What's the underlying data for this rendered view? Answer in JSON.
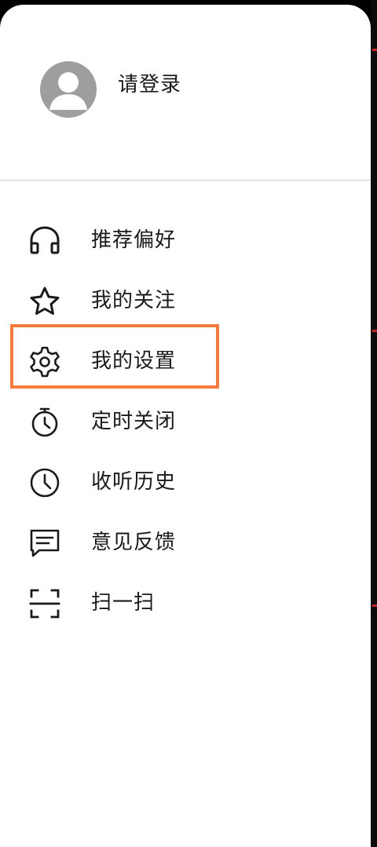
{
  "profile": {
    "login_label": "请登录",
    "avatar_icon": "person-avatar-icon"
  },
  "menu": {
    "items": [
      {
        "label": "推荐偏好",
        "icon": "headphones-icon"
      },
      {
        "label": "我的关注",
        "icon": "star-icon"
      },
      {
        "label": "我的设置",
        "icon": "gear-icon"
      },
      {
        "label": "定时关闭",
        "icon": "timer-icon"
      },
      {
        "label": "收听历史",
        "icon": "clock-icon"
      },
      {
        "label": "意见反馈",
        "icon": "chat-icon"
      },
      {
        "label": "扫一扫",
        "icon": "scan-icon"
      }
    ]
  },
  "colors": {
    "highlight": "#f47c3c",
    "avatar": "#9e9e9e",
    "text": "#1a1a1a"
  }
}
